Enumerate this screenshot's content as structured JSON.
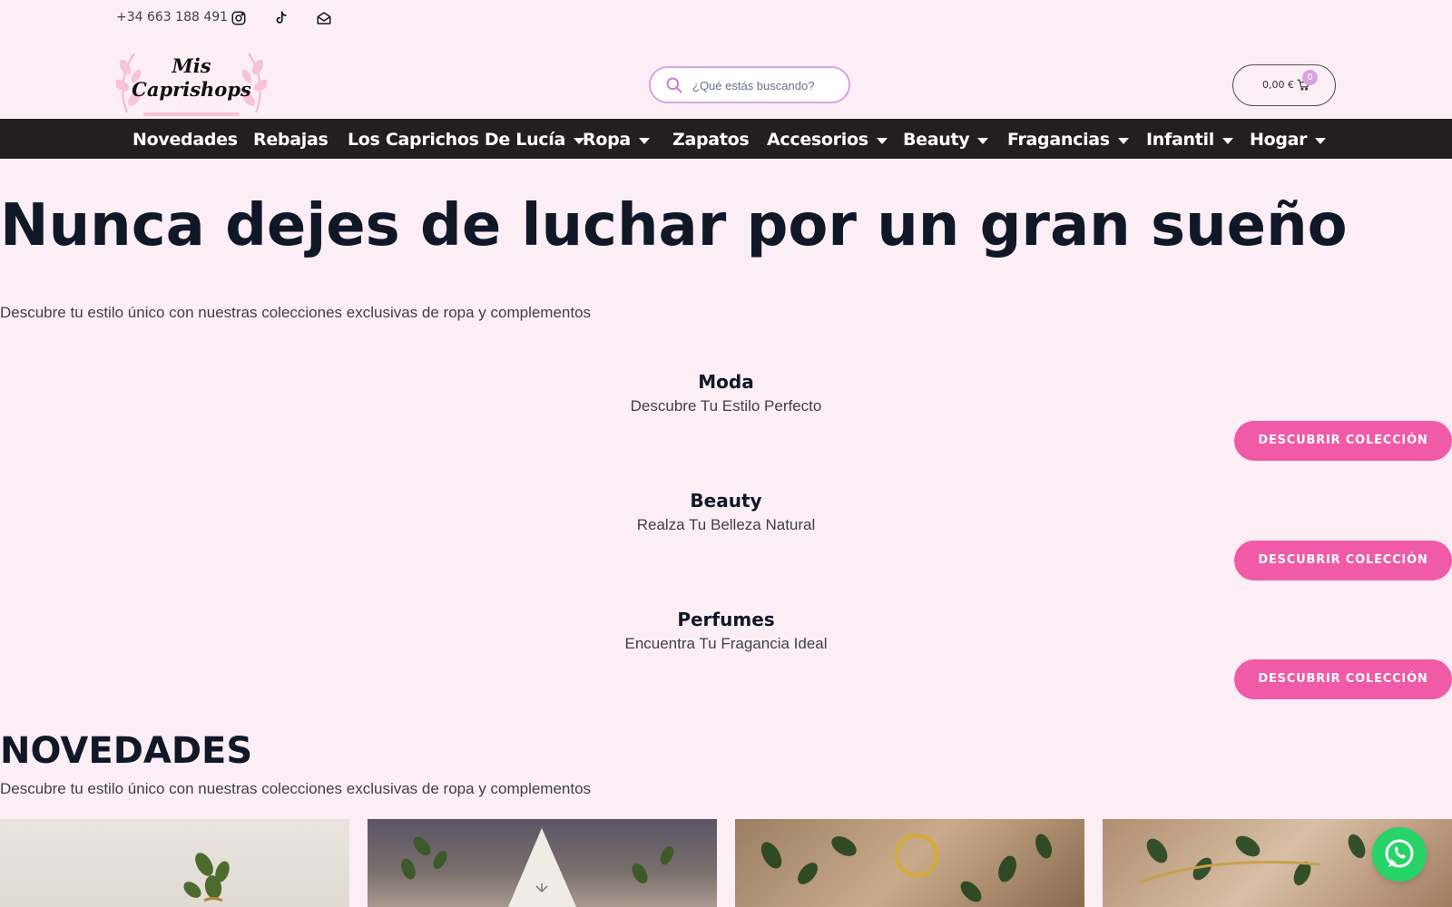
{
  "topbar": {
    "phone": "+34 663 188 491",
    "icons": [
      "instagram-icon",
      "tiktok-icon",
      "mail-icon"
    ]
  },
  "header": {
    "logo_text_line1": "Mis",
    "logo_text_line2": "Caprishops",
    "search_placeholder": "¿Qué estás buscando?",
    "cart_amount": "0,00 €",
    "cart_count": "0"
  },
  "nav": {
    "items": [
      {
        "label": "Novedades",
        "dropdown": false
      },
      {
        "label": "Rebajas",
        "dropdown": false
      },
      {
        "label": "Los Caprichos De Lucía",
        "dropdown": true
      },
      {
        "label": "Ropa",
        "dropdown": true
      },
      {
        "label": "Zapatos",
        "dropdown": false
      },
      {
        "label": "Accesorios",
        "dropdown": true
      },
      {
        "label": "Beauty",
        "dropdown": true
      },
      {
        "label": "Fragancias",
        "dropdown": true
      },
      {
        "label": "Infantil",
        "dropdown": true
      },
      {
        "label": "Hogar",
        "dropdown": true
      }
    ]
  },
  "hero": {
    "title": "Nunca dejes de luchar por un gran sueño",
    "subtitle": "Descubre tu estilo único con nuestras colecciones exclusivas de ropa y complementos"
  },
  "collections": [
    {
      "title": "Moda",
      "subtitle": "Descubre Tu Estilo Perfecto",
      "cta": "DESCUBRIR COLECCIÓN"
    },
    {
      "title": "Beauty",
      "subtitle": "Realza Tu Belleza Natural",
      "cta": "DESCUBRIR COLECCIÓN"
    },
    {
      "title": "Perfumes",
      "subtitle": "Encuentra Tu Fragancia Ideal",
      "cta": "DESCUBRIR COLECCIÓN"
    }
  ],
  "novedades": {
    "title": "NOVEDADES",
    "subtitle": "Descubre tu estilo único con nuestras colecciones exclusivas de ropa y complementos"
  },
  "colors": {
    "background": "#fceef5",
    "nav_bg": "#231f20",
    "cta": "#f15aa6",
    "search_border": "#d8a3e0",
    "whatsapp": "#25d366"
  }
}
